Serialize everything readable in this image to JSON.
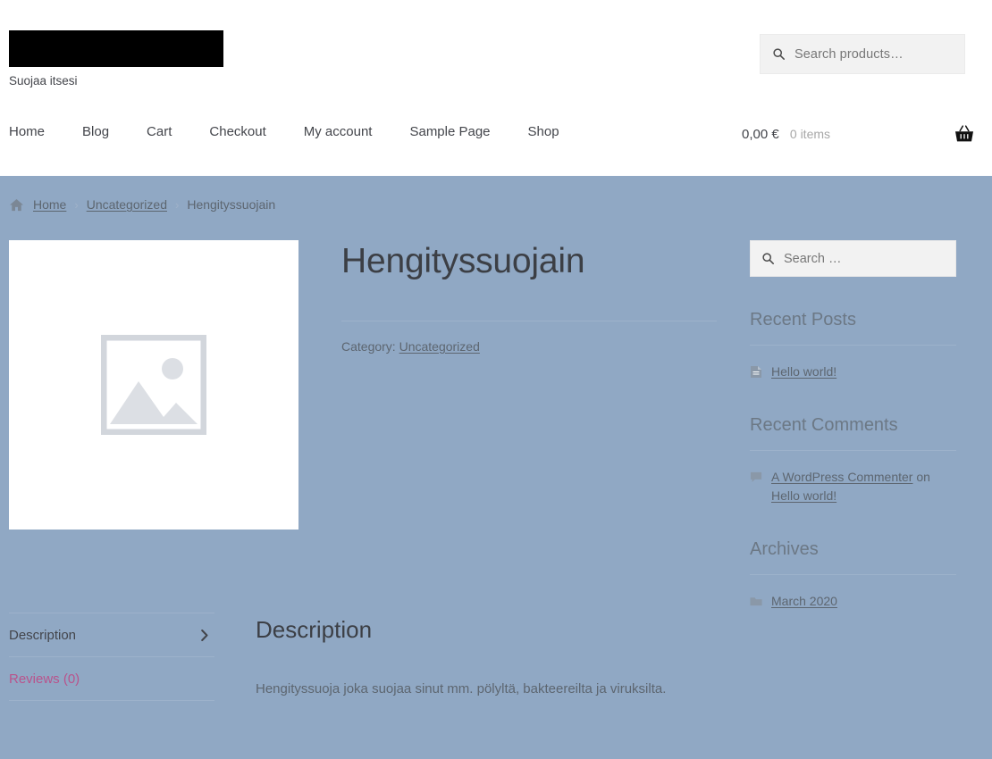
{
  "site": {
    "logo": "redacted-logo-block",
    "tagline": "Suojaa itsesi"
  },
  "product_search": {
    "placeholder": "Search products…",
    "icon": "search-icon"
  },
  "nav": {
    "items": [
      {
        "label": "Home"
      },
      {
        "label": "Blog"
      },
      {
        "label": "Cart"
      },
      {
        "label": "Checkout"
      },
      {
        "label": "My account"
      },
      {
        "label": "Sample Page"
      },
      {
        "label": "Shop"
      }
    ]
  },
  "cart": {
    "amount": "0,00 €",
    "count": "0 items",
    "icon": "shopping-basket-icon"
  },
  "breadcrumb": {
    "home_icon": "home-icon",
    "items": [
      {
        "label": "Home",
        "link": true
      },
      {
        "label": "Uncategorized",
        "link": true
      },
      {
        "label": "Hengityssuojain",
        "link": false
      }
    ],
    "separator": "›"
  },
  "product": {
    "title": "Hengityssuojain",
    "image_placeholder_icon": "image-placeholder-icon",
    "meta_label": "Category:",
    "category": "Uncategorized"
  },
  "tabs": {
    "items": [
      {
        "label": "Description",
        "active": true
      },
      {
        "label": "Reviews (0)",
        "active": false
      }
    ],
    "chevron_icon": "chevron-right-icon"
  },
  "panel": {
    "title": "Description",
    "text": "Hengityssuoja joka suojaa sinut mm. pölyltä, bakteereilta ja viruksilta."
  },
  "sidebar": {
    "search": {
      "placeholder": "Search …",
      "icon": "search-icon"
    },
    "recent_posts": {
      "title": "Recent Posts",
      "items": [
        {
          "icon": "document-icon",
          "label": "Hello world!"
        }
      ]
    },
    "recent_comments": {
      "title": "Recent Comments",
      "items": [
        {
          "icon": "comment-bubble-icon",
          "author": "A WordPress Commenter",
          "connector": " on ",
          "post": "Hello world!"
        }
      ]
    },
    "archives": {
      "title": "Archives",
      "items": [
        {
          "icon": "folder-icon",
          "label": "March 2020"
        }
      ]
    }
  },
  "colors": {
    "page_background": "#90a8c4",
    "header_background": "#ffffff",
    "text": "#43454b",
    "muted_text": "#5d6670",
    "accent_reviews": "#b9538c",
    "input_background": "#f2f2f2"
  }
}
